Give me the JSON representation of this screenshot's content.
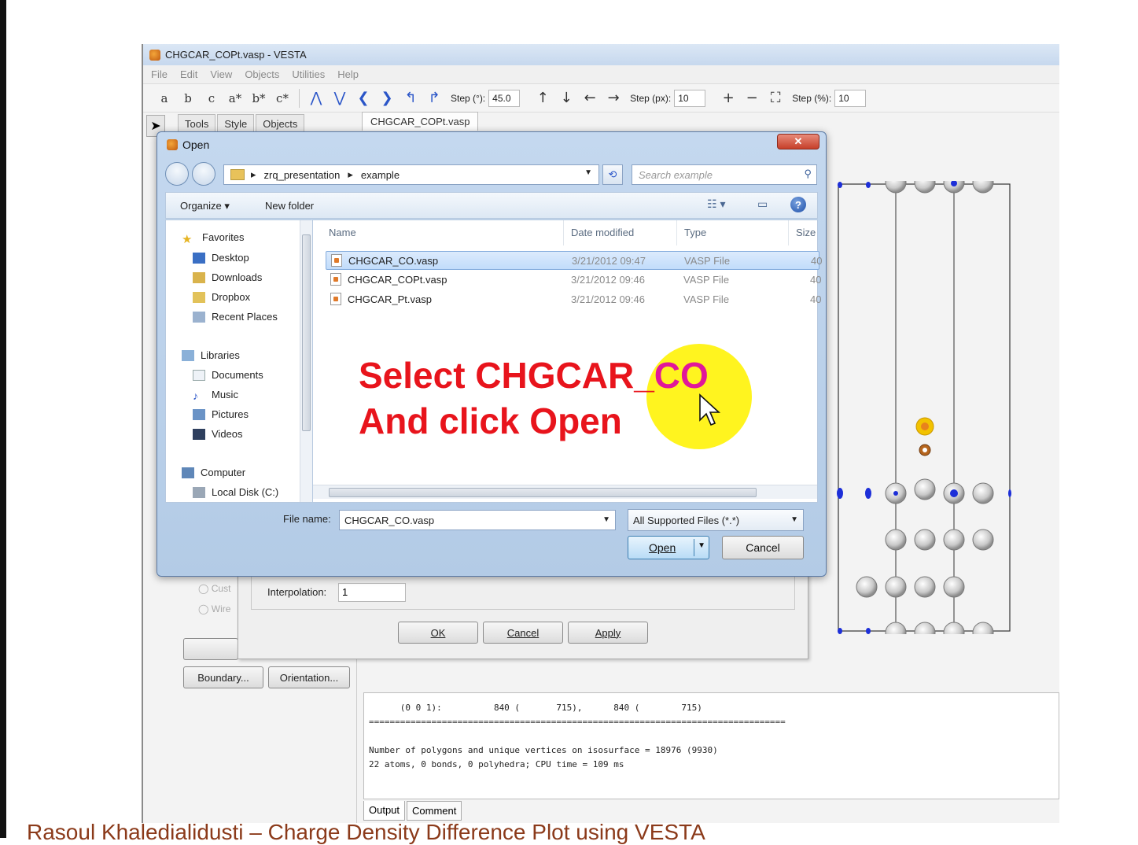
{
  "vesta": {
    "title": "CHGCAR_COPt.vasp - VESTA",
    "menu": [
      "File",
      "Edit",
      "View",
      "Objects",
      "Utilities",
      "Help"
    ],
    "toolbar": {
      "axis_buttons": [
        "a",
        "b",
        "c",
        "a*",
        "b*",
        "c*"
      ],
      "step_deg_label": "Step (°):",
      "step_deg_value": "45.0",
      "step_px_label": "Step (px):",
      "step_px_value": "10",
      "step_pct_label": "Step (%):",
      "step_pct_value": "10"
    },
    "side_tabs": [
      "Tools",
      "Style",
      "Objects"
    ],
    "document_tab": "CHGCAR_COPt.vasp",
    "properties": {
      "interpolation_label": "Interpolation:",
      "interpolation_value": "1",
      "ok": "OK",
      "cancel": "Cancel",
      "apply": "Apply"
    },
    "radio_labels": [
      "Cust",
      "Wire"
    ],
    "boundary_button": "Boundary...",
    "orientation_button": "Orientation...",
    "output": {
      "lines": [
        "      (0 0 1):          840 (       715),      840 (        715)",
        "================================================================================",
        "",
        "Number of polygons and unique vertices on isosurface = 18976 (9930)",
        "22 atoms, 0 bonds, 0 polyhedra; CPU time = 109 ms"
      ]
    },
    "output_tabs": [
      "Output",
      "Comment"
    ]
  },
  "dialog": {
    "title": "Open",
    "close": "✕",
    "breadcrumb": [
      "zrq_presentation",
      "example"
    ],
    "search_placeholder": "Search example",
    "organize": "Organize ▾",
    "new_folder": "New folder",
    "nav": {
      "favorites": "Favorites",
      "favorites_items": [
        "Desktop",
        "Downloads",
        "Dropbox",
        "Recent Places"
      ],
      "libraries": "Libraries",
      "libraries_items": [
        "Documents",
        "Music",
        "Pictures",
        "Videos"
      ],
      "computer": "Computer",
      "computer_items": [
        "Local Disk (C:)"
      ]
    },
    "columns": {
      "name": "Name",
      "date": "Date modified",
      "type": "Type",
      "size": "Size"
    },
    "files": [
      {
        "name": "CHGCAR_CO.vasp",
        "date": "3/21/2012 09:47",
        "type": "VASP File",
        "size": "40"
      },
      {
        "name": "CHGCAR_COPt.vasp",
        "date": "3/21/2012 09:46",
        "type": "VASP File",
        "size": "40"
      },
      {
        "name": "CHGCAR_Pt.vasp",
        "date": "3/21/2012 09:46",
        "type": "VASP File",
        "size": "40"
      }
    ],
    "selected_index": 0,
    "file_name_label": "File name:",
    "file_name_value": "CHGCAR_CO.vasp",
    "file_type": "All Supported Files (*.*)",
    "open": "Open",
    "cancel": "Cancel"
  },
  "annotation": {
    "line1_prefix": "Select CHGCAR_",
    "line1_highlight": "CO",
    "line2": "And click Open",
    "colors": {
      "text": "#e8141c",
      "highlight_text": "#e1179a",
      "spot": "#fff200"
    }
  },
  "caption": "Rasoul Khaledialidusti – Charge Density Difference Plot using VESTA"
}
